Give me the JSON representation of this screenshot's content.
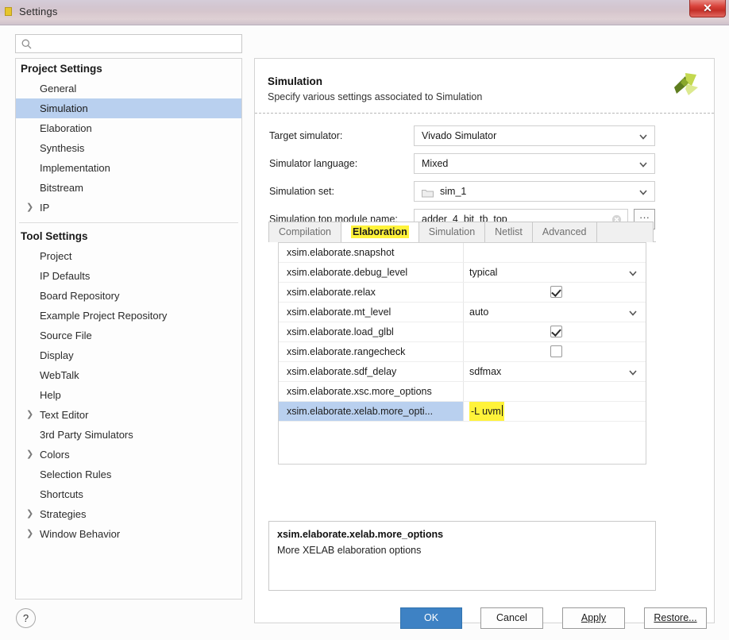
{
  "window": {
    "title": "Settings",
    "icon": "vivado-app-icon",
    "close_label": "✕"
  },
  "search": {
    "placeholder": "",
    "value": "",
    "icon": "search-icon"
  },
  "sidebar": {
    "groups": [
      {
        "title": "Project Settings",
        "items": [
          {
            "label": "General",
            "expandable": false,
            "selected": false
          },
          {
            "label": "Simulation",
            "expandable": false,
            "selected": true
          },
          {
            "label": "Elaboration",
            "expandable": false,
            "selected": false
          },
          {
            "label": "Synthesis",
            "expandable": false,
            "selected": false
          },
          {
            "label": "Implementation",
            "expandable": false,
            "selected": false
          },
          {
            "label": "Bitstream",
            "expandable": false,
            "selected": false
          },
          {
            "label": "IP",
            "expandable": true,
            "selected": false
          }
        ]
      },
      {
        "title": "Tool Settings",
        "items": [
          {
            "label": "Project",
            "expandable": false,
            "selected": false
          },
          {
            "label": "IP Defaults",
            "expandable": false,
            "selected": false
          },
          {
            "label": "Board Repository",
            "expandable": false,
            "selected": false
          },
          {
            "label": "Example Project Repository",
            "expandable": false,
            "selected": false
          },
          {
            "label": "Source File",
            "expandable": false,
            "selected": false
          },
          {
            "label": "Display",
            "expandable": false,
            "selected": false
          },
          {
            "label": "WebTalk",
            "expandable": false,
            "selected": false
          },
          {
            "label": "Help",
            "expandable": false,
            "selected": false
          },
          {
            "label": "Text Editor",
            "expandable": true,
            "selected": false
          },
          {
            "label": "3rd Party Simulators",
            "expandable": false,
            "selected": false
          },
          {
            "label": "Colors",
            "expandable": true,
            "selected": false
          },
          {
            "label": "Selection Rules",
            "expandable": false,
            "selected": false
          },
          {
            "label": "Shortcuts",
            "expandable": false,
            "selected": false
          },
          {
            "label": "Strategies",
            "expandable": true,
            "selected": false
          },
          {
            "label": "Window Behavior",
            "expandable": true,
            "selected": false
          }
        ]
      }
    ]
  },
  "panel": {
    "title": "Simulation",
    "subtitle": "Specify various settings associated to Simulation",
    "logo_icon": "vivado-logo-icon",
    "fields": [
      {
        "label": "Target simulator:",
        "value": "Vivado Simulator",
        "type": "combo"
      },
      {
        "label": "Simulator language:",
        "value": "Mixed",
        "type": "combo"
      },
      {
        "label": "Simulation set:",
        "value": "sim_1",
        "type": "combo-folder"
      },
      {
        "label": "Simulation top module name:",
        "value": "adder_4_bit_tb_top",
        "type": "text"
      }
    ],
    "browse_button_label": "···"
  },
  "tabs": [
    {
      "label": "Compilation",
      "active": false,
      "highlighted": false
    },
    {
      "label": "Elaboration",
      "active": true,
      "highlighted": true
    },
    {
      "label": "Simulation",
      "active": false,
      "highlighted": false
    },
    {
      "label": "Netlist",
      "active": false,
      "highlighted": false
    },
    {
      "label": "Advanced",
      "active": false,
      "highlighted": false
    }
  ],
  "properties": [
    {
      "name": "xsim.elaborate.snapshot",
      "value": "",
      "control": "text",
      "selected": false,
      "highlighted": false
    },
    {
      "name": "xsim.elaborate.debug_level",
      "value": "typical",
      "control": "combo",
      "selected": false,
      "highlighted": false
    },
    {
      "name": "xsim.elaborate.relax",
      "value": "",
      "control": "checkbox",
      "checked": true,
      "selected": false,
      "highlighted": false
    },
    {
      "name": "xsim.elaborate.mt_level",
      "value": "auto",
      "control": "combo",
      "selected": false,
      "highlighted": false
    },
    {
      "name": "xsim.elaborate.load_glbl",
      "value": "",
      "control": "checkbox",
      "checked": true,
      "selected": false,
      "highlighted": false
    },
    {
      "name": "xsim.elaborate.rangecheck",
      "value": "",
      "control": "checkbox",
      "checked": false,
      "selected": false,
      "highlighted": false
    },
    {
      "name": "xsim.elaborate.sdf_delay",
      "value": "sdfmax",
      "control": "combo",
      "selected": false,
      "highlighted": false
    },
    {
      "name": "xsim.elaborate.xsc.more_options",
      "value": "",
      "control": "text",
      "selected": false,
      "highlighted": false
    },
    {
      "name": "xsim.elaborate.xelab.more_opti...",
      "value": "-L uvm",
      "control": "text",
      "selected": true,
      "highlighted": true
    }
  ],
  "description": {
    "title": "xsim.elaborate.xelab.more_options",
    "text": "More XELAB elaboration options"
  },
  "footer": {
    "help_label": "?",
    "buttons": [
      {
        "label": "OK",
        "primary": true,
        "mnemonic": ""
      },
      {
        "label": "Cancel",
        "primary": false,
        "mnemonic": ""
      },
      {
        "label": "Apply",
        "primary": false,
        "mnemonic": "A"
      },
      {
        "label": "Restore...",
        "primary": false,
        "mnemonic": "R"
      }
    ]
  },
  "colors": {
    "selection_blue": "#b9d0ef",
    "highlight_yellow": "#fff33a",
    "primary_button": "#3e82c4",
    "close_red": "#c32f27",
    "logo_green": "#a8c63c"
  }
}
